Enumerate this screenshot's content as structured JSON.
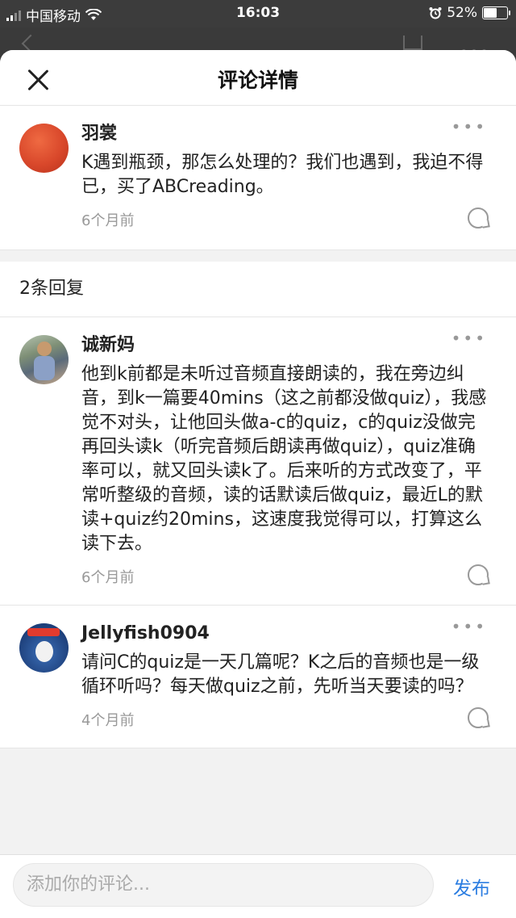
{
  "status": {
    "carrier": "中国移动",
    "time": "16:03",
    "battery": "52%",
    "battery_level": 0.52
  },
  "sheet": {
    "title": "评论详情"
  },
  "main_comment": {
    "name": "羽裳",
    "text": "K遇到瓶颈，那怎么处理的？我们也遇到，我迫不得已，买了ABCreading。",
    "time": "6个月前",
    "avatar_color": "#d9482b"
  },
  "replies_header": "2条回复",
  "replies": [
    {
      "name": "诚新妈",
      "text": "他到k前都是未听过音频直接朗读的，我在旁边纠音，到k一篇要40mins（这之前都没做quiz），我感觉不对头，让他回头做a-c的quiz，c的quiz没做完再回头读k（听完音频后朗读再做quiz），quiz准确率可以，就又回头读k了。后来听的方式改变了，平常听整级的音频，读的话默读后做quiz，最近L的默读+quiz约20mins，这速度我觉得可以，打算这么读下去。",
      "time": "6个月前"
    },
    {
      "name": "Jellyfish0904",
      "text": "请问C的quiz是一天几篇呢？K之后的音频也是一级循环听吗？每天做quiz之前，先听当天要读的吗？",
      "time": "4个月前"
    }
  ],
  "footer": {
    "placeholder": "添加你的评论...",
    "publish": "发布"
  },
  "colors": {
    "accent": "#2b7de1",
    "muted": "#999999"
  }
}
